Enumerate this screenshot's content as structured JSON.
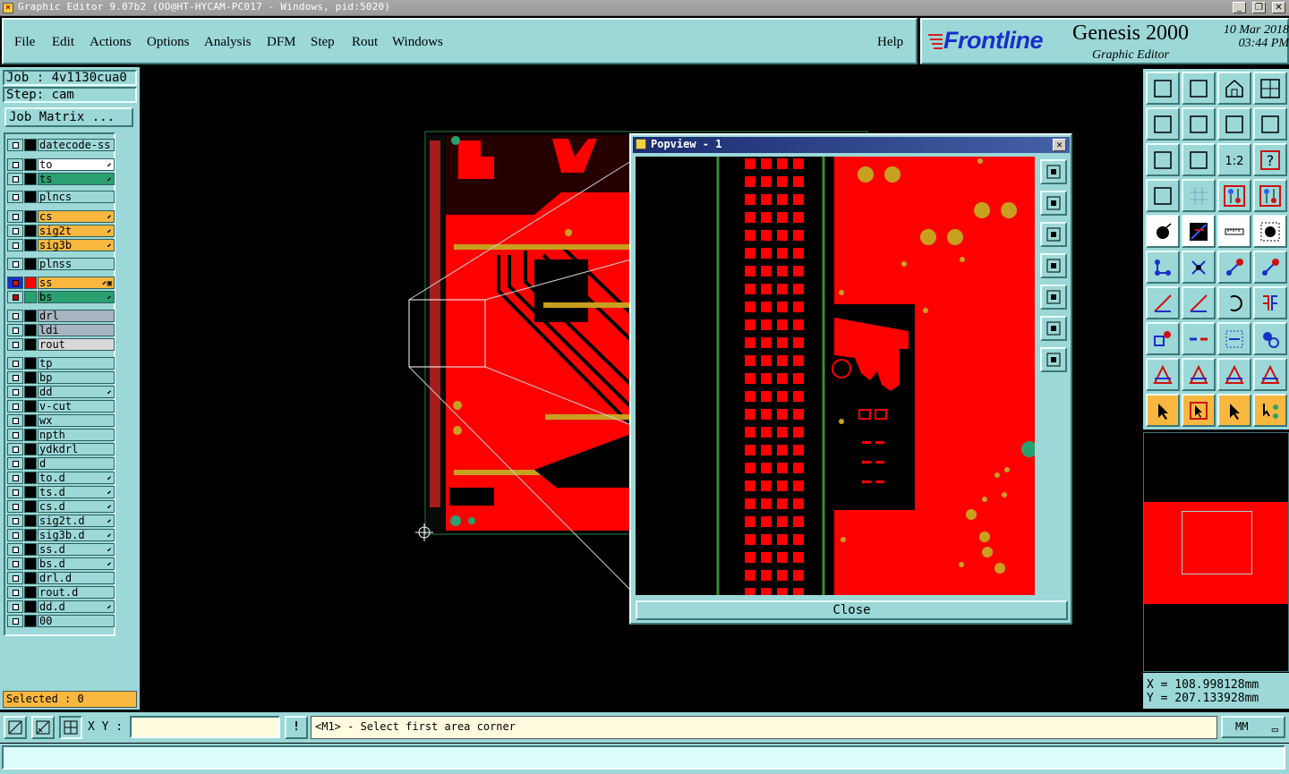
{
  "window": {
    "title": "Graphic Editor 9.07b2 (OO@HT-HYCAM-PC017 - Windows, pid:5020)",
    "minimize": "_",
    "maximize": "❐",
    "close": "✕"
  },
  "menu": {
    "file": "File",
    "edit": "Edit",
    "actions": "Actions",
    "options": "Options",
    "analysis": "Analysis",
    "dfm": "DFM",
    "step": "Step",
    "rout": "Rout",
    "windows": "Windows",
    "help": "Help"
  },
  "brand": {
    "logo": "Frontline",
    "product": "Genesis 2000",
    "subtitle": "Graphic Editor",
    "date": "10 Mar 2018",
    "time": "03:44 PM"
  },
  "job": {
    "job_label": "Job : 4v1130cua0",
    "step_label": "Step: cam",
    "matrix_button": "Job Matrix ..."
  },
  "layers": [
    {
      "name": "datecode-ss",
      "color": "#9cd8d8",
      "mark": ""
    },
    {
      "name": "to",
      "color": "#ffffff",
      "mark": "⬋"
    },
    {
      "name": "ts",
      "color": "#2aa070",
      "mark": "⬋"
    },
    {
      "name": "plncs",
      "color": "#9cd8d8",
      "mark": ""
    },
    {
      "name": "cs",
      "color": "#f8b840",
      "mark": "⬋"
    },
    {
      "name": "sig2t",
      "color": "#f8b840",
      "mark": "⬋"
    },
    {
      "name": "sig3b",
      "color": "#f8b840",
      "mark": "⬋"
    },
    {
      "name": "plnss",
      "color": "#9cd8d8",
      "mark": ""
    },
    {
      "name": "ss",
      "color": "#f8b840",
      "mark": "⬋▣"
    },
    {
      "name": "bs",
      "color": "#2aa070",
      "mark": "⬋"
    },
    {
      "name": "drl",
      "color": "#a8b4c0",
      "mark": ""
    },
    {
      "name": "ldi",
      "color": "#a8b4c0",
      "mark": ""
    },
    {
      "name": "rout",
      "color": "#d8d8d8",
      "mark": ""
    },
    {
      "name": "tp",
      "color": "#9cd8d8",
      "mark": ""
    },
    {
      "name": "bp",
      "color": "#9cd8d8",
      "mark": ""
    },
    {
      "name": "dd",
      "color": "#9cd8d8",
      "mark": "⬋"
    },
    {
      "name": "v-cut",
      "color": "#9cd8d8",
      "mark": ""
    },
    {
      "name": "wx",
      "color": "#9cd8d8",
      "mark": ""
    },
    {
      "name": "npth",
      "color": "#9cd8d8",
      "mark": ""
    },
    {
      "name": "ydkdrl",
      "color": "#9cd8d8",
      "mark": ""
    },
    {
      "name": "d",
      "color": "#9cd8d8",
      "mark": ""
    },
    {
      "name": "to.d",
      "color": "#9cd8d8",
      "mark": "⬋"
    },
    {
      "name": "ts.d",
      "color": "#9cd8d8",
      "mark": "⬋"
    },
    {
      "name": "cs.d",
      "color": "#9cd8d8",
      "mark": "⬋"
    },
    {
      "name": "sig2t.d",
      "color": "#9cd8d8",
      "mark": "⬋"
    },
    {
      "name": "sig3b.d",
      "color": "#9cd8d8",
      "mark": "⬋"
    },
    {
      "name": "ss.d",
      "color": "#9cd8d8",
      "mark": "⬋"
    },
    {
      "name": "bs.d",
      "color": "#9cd8d8",
      "mark": "⬋"
    },
    {
      "name": "drl.d",
      "color": "#9cd8d8",
      "mark": ""
    },
    {
      "name": "rout.d",
      "color": "#9cd8d8",
      "mark": ""
    },
    {
      "name": "dd.d",
      "color": "#9cd8d8",
      "mark": "⬋"
    },
    {
      "name": "00",
      "color": "#9cd8d8",
      "mark": ""
    }
  ],
  "selected": "Selected : 0",
  "status": {
    "xy_label": "X Y :",
    "xy_value": "",
    "alert_icon": "!",
    "message": "<M1> - Select first area corner",
    "units": "MM"
  },
  "coords": {
    "x": "X  =  108.998128mm",
    "y": "Y  =  207.133928mm"
  },
  "popview": {
    "title": "Popview - 1",
    "close_label": "Close"
  },
  "colors": {
    "panel": "#9cd8d8",
    "copper": "#ff0000",
    "highlight": "#f8b840",
    "silk": "#c8a020",
    "drill": "#2aa070"
  }
}
